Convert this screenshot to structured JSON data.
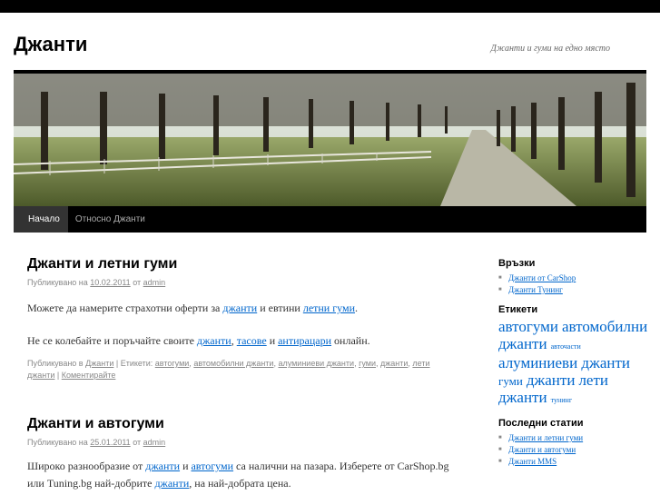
{
  "site": {
    "title": "Джанти",
    "description": "Джанти и гуми на едно място"
  },
  "nav": {
    "items": [
      {
        "label": "Начало"
      },
      {
        "label": "Относно Джанти"
      }
    ]
  },
  "posts": [
    {
      "title": "Джанти и летни гуми",
      "meta_prefix": "Публикувано на",
      "date": "10.02.2011",
      "meta_by": "от",
      "author": "admin",
      "p1": {
        "pre": "Можете да намерите страхотни оферти за",
        "link1": "джанти",
        "mid": "и евтини",
        "link2": "летни гуми",
        "post": "."
      },
      "p2": {
        "pre": "Не се колебайте и поръчайте своите",
        "link1": "джанти",
        "sep1": ",",
        "link2": "тасове",
        "sep2": "и",
        "link3": "антирацари",
        "post": "онлайн."
      },
      "footer": {
        "posted_in": "Публикувано в",
        "category": "Джанти",
        "tags_label": "| Етикети:",
        "tags": [
          "автогуми",
          "автомобилни джанти",
          "алуминиеви джанти",
          "гуми",
          "джанти",
          "лети джанти"
        ],
        "comment": "Коментирайте"
      }
    },
    {
      "title": "Джанти и автогуми",
      "meta_prefix": "Публикувано на",
      "date": "25.01.2011",
      "meta_by": "от",
      "author": "admin",
      "p1": {
        "pre": "Широко разнообразие от",
        "link1": "джанти",
        "mid": "и",
        "link2": "автогуми",
        "post": "са налични на пазара. Изберете от CarShop.bg или Tuning.bg най-добрите",
        "link3": "джанти",
        "end": ", на най-добрата цена."
      }
    }
  ],
  "sidebar": {
    "links_title": "Връзки",
    "links": [
      "Джанти от CarShop",
      "Джанти Тунинг"
    ],
    "tags_title": "Етикети",
    "tag_cloud": [
      {
        "label": "автогуми",
        "size": 17
      },
      {
        "label": "автомобилни джанти",
        "size": 17
      },
      {
        "label": "авточасти",
        "size": 8
      },
      {
        "label": "алуминиеви джанти",
        "size": 17
      },
      {
        "label": "гуми",
        "size": 13
      },
      {
        "label": "джанти",
        "size": 17
      },
      {
        "label": "лети джанти",
        "size": 17
      },
      {
        "label": "тунинг",
        "size": 8
      }
    ],
    "recent_title": "Последни статии",
    "recent": [
      "Джанти и летни гуми",
      "Джанти и автогуми",
      "Джанти MMS"
    ]
  },
  "colors": {
    "link": "#0066cc",
    "topbar": "#000000",
    "meta": "#888888"
  }
}
